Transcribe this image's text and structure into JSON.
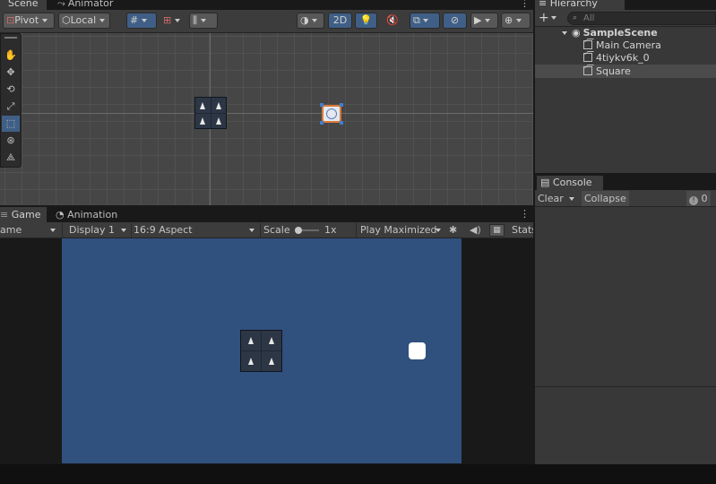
{
  "scene_panel": {
    "tabs": [
      {
        "label": "Scene",
        "active": true
      },
      {
        "label": "Animator",
        "active": false
      }
    ],
    "toolbar": {
      "pivot_label": "Pivot",
      "local_label": "Local",
      "mode_2d_label": "2D"
    },
    "tools": [
      "hand-tool",
      "move-tool",
      "rotate-tool",
      "scale-tool",
      "rect-tool",
      "transform-tool",
      "custom-tool"
    ]
  },
  "game_panel": {
    "tabs": [
      {
        "label": "Game",
        "active": true
      },
      {
        "label": "Animation",
        "active": false
      }
    ],
    "toolbar": {
      "view_label": "ame",
      "display_label": "Display 1",
      "aspect_label": "16:9 Aspect",
      "scale_label": "Scale",
      "scale_value": "1x",
      "play_mode_label": "Play Maximized",
      "stats_label": "Stats"
    }
  },
  "hierarchy": {
    "title": "Hierarchy",
    "search_placeholder": "All",
    "scene_name": "SampleScene",
    "items": [
      {
        "label": "Main Camera",
        "selected": false
      },
      {
        "label": "4tiykv6k_0",
        "selected": false
      },
      {
        "label": "Square",
        "selected": true
      }
    ]
  },
  "console": {
    "title": "Console",
    "clear_label": "Clear",
    "collapse_label": "Collapse",
    "count": "0"
  },
  "colors": {
    "accent": "#3f5f86",
    "game_background": "#30507e",
    "scene_background": "#464646"
  }
}
